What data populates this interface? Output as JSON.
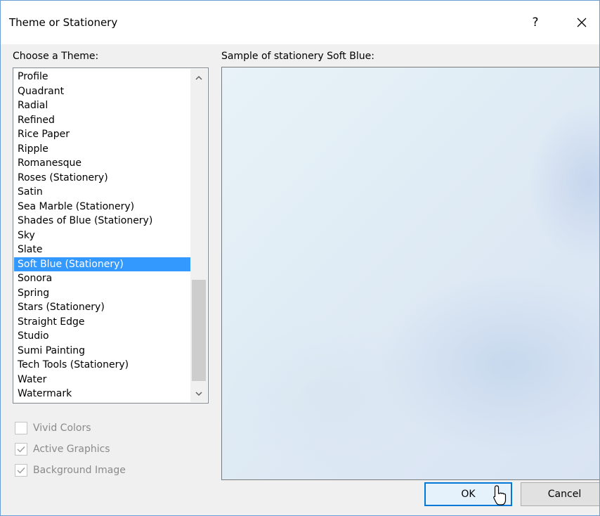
{
  "dialog": {
    "title": "Theme or Stationery",
    "help_label": "?",
    "close_icon": "close-icon"
  },
  "theme_list": {
    "label": "Choose a Theme:",
    "items": [
      "Profile",
      "Quadrant",
      "Radial",
      "Refined",
      "Rice Paper",
      "Ripple",
      "Romanesque",
      "Roses (Stationery)",
      "Satin",
      "Sea Marble (Stationery)",
      "Shades of Blue (Stationery)",
      "Sky",
      "Slate",
      "Soft Blue (Stationery)",
      "Sonora",
      "Spring",
      "Stars (Stationery)",
      "Straight Edge",
      "Studio",
      "Sumi Painting",
      "Tech Tools (Stationery)",
      "Water",
      "Watermark"
    ],
    "selected": "Soft Blue (Stationery)"
  },
  "sample": {
    "label": "Sample of stationery Soft Blue:"
  },
  "options": {
    "vivid_colors": {
      "label": "Vivid Colors",
      "checked": false
    },
    "active_graphics": {
      "label": "Active Graphics",
      "checked": true
    },
    "background_image": {
      "label": "Background Image",
      "checked": true
    }
  },
  "buttons": {
    "ok": "OK",
    "cancel": "Cancel"
  },
  "colors": {
    "selection": "#3399ff",
    "accent_border": "#0078d7"
  }
}
